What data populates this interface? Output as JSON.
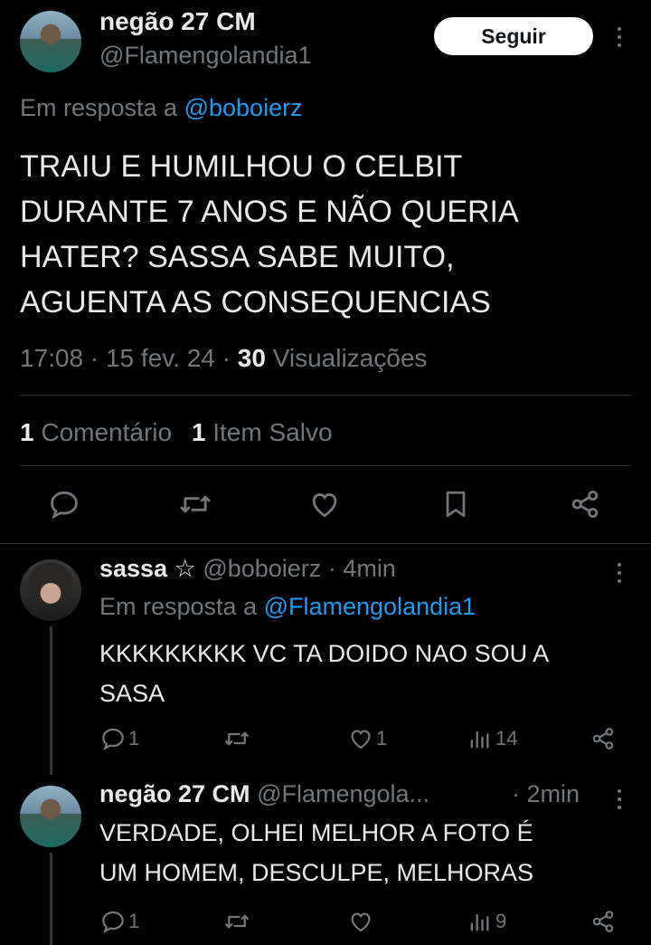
{
  "main_tweet": {
    "author_name": "negão 27 CM",
    "author_handle": "@Flamengolandia1",
    "follow_label": "Seguir",
    "reply_prefix": "Em resposta a",
    "reply_to": "@boboierz",
    "text_lines": [
      "TRAIU E HUMILHOU O CELBIT",
      "DURANTE 7 ANOS E NÃO QUERIA",
      "HATER? SASSA SABE MUITO,",
      "AGUENTA AS CONSEQUENCIAS"
    ],
    "time": "17:08",
    "sep": "·",
    "date": "15 fev. 24",
    "views_count": "30",
    "views_label": "Visualizações",
    "comments_count": "1",
    "comments_label": "Comentário",
    "saved_count": "1",
    "saved_label": "Item Salvo"
  },
  "replies": [
    {
      "author_name": "sassa ☆",
      "author_handle": "@boboierz",
      "time": "· 4min",
      "reply_prefix": "Em resposta a",
      "reply_to": "@Flamengolandia1",
      "text_lines": [
        "KKKKKKKKK VC TA DOIDO NAO SOU A",
        "SASA"
      ],
      "replies_count": "1",
      "likes_count": "1",
      "views_count": "14"
    },
    {
      "author_name": "negão 27 CM",
      "author_handle": "@Flamengola...",
      "time": "· 2min",
      "text_lines": [
        "VERDADE, OLHEI MELHOR A FOTO É",
        "UM HOMEM, DESCULPE, MELHORAS"
      ],
      "replies_count": "1",
      "views_count": "9"
    }
  ],
  "icons": {
    "reply": "comment-icon",
    "retweet": "retweet-icon",
    "like": "heart-icon",
    "bookmark": "bookmark-icon",
    "share": "share-icon",
    "views": "views-icon",
    "more": "more-icon"
  },
  "colors": {
    "background": "#000000",
    "text": "#e7e9ea",
    "muted": "#71767b",
    "link": "#1d9bf0",
    "divider": "#2f3336"
  }
}
